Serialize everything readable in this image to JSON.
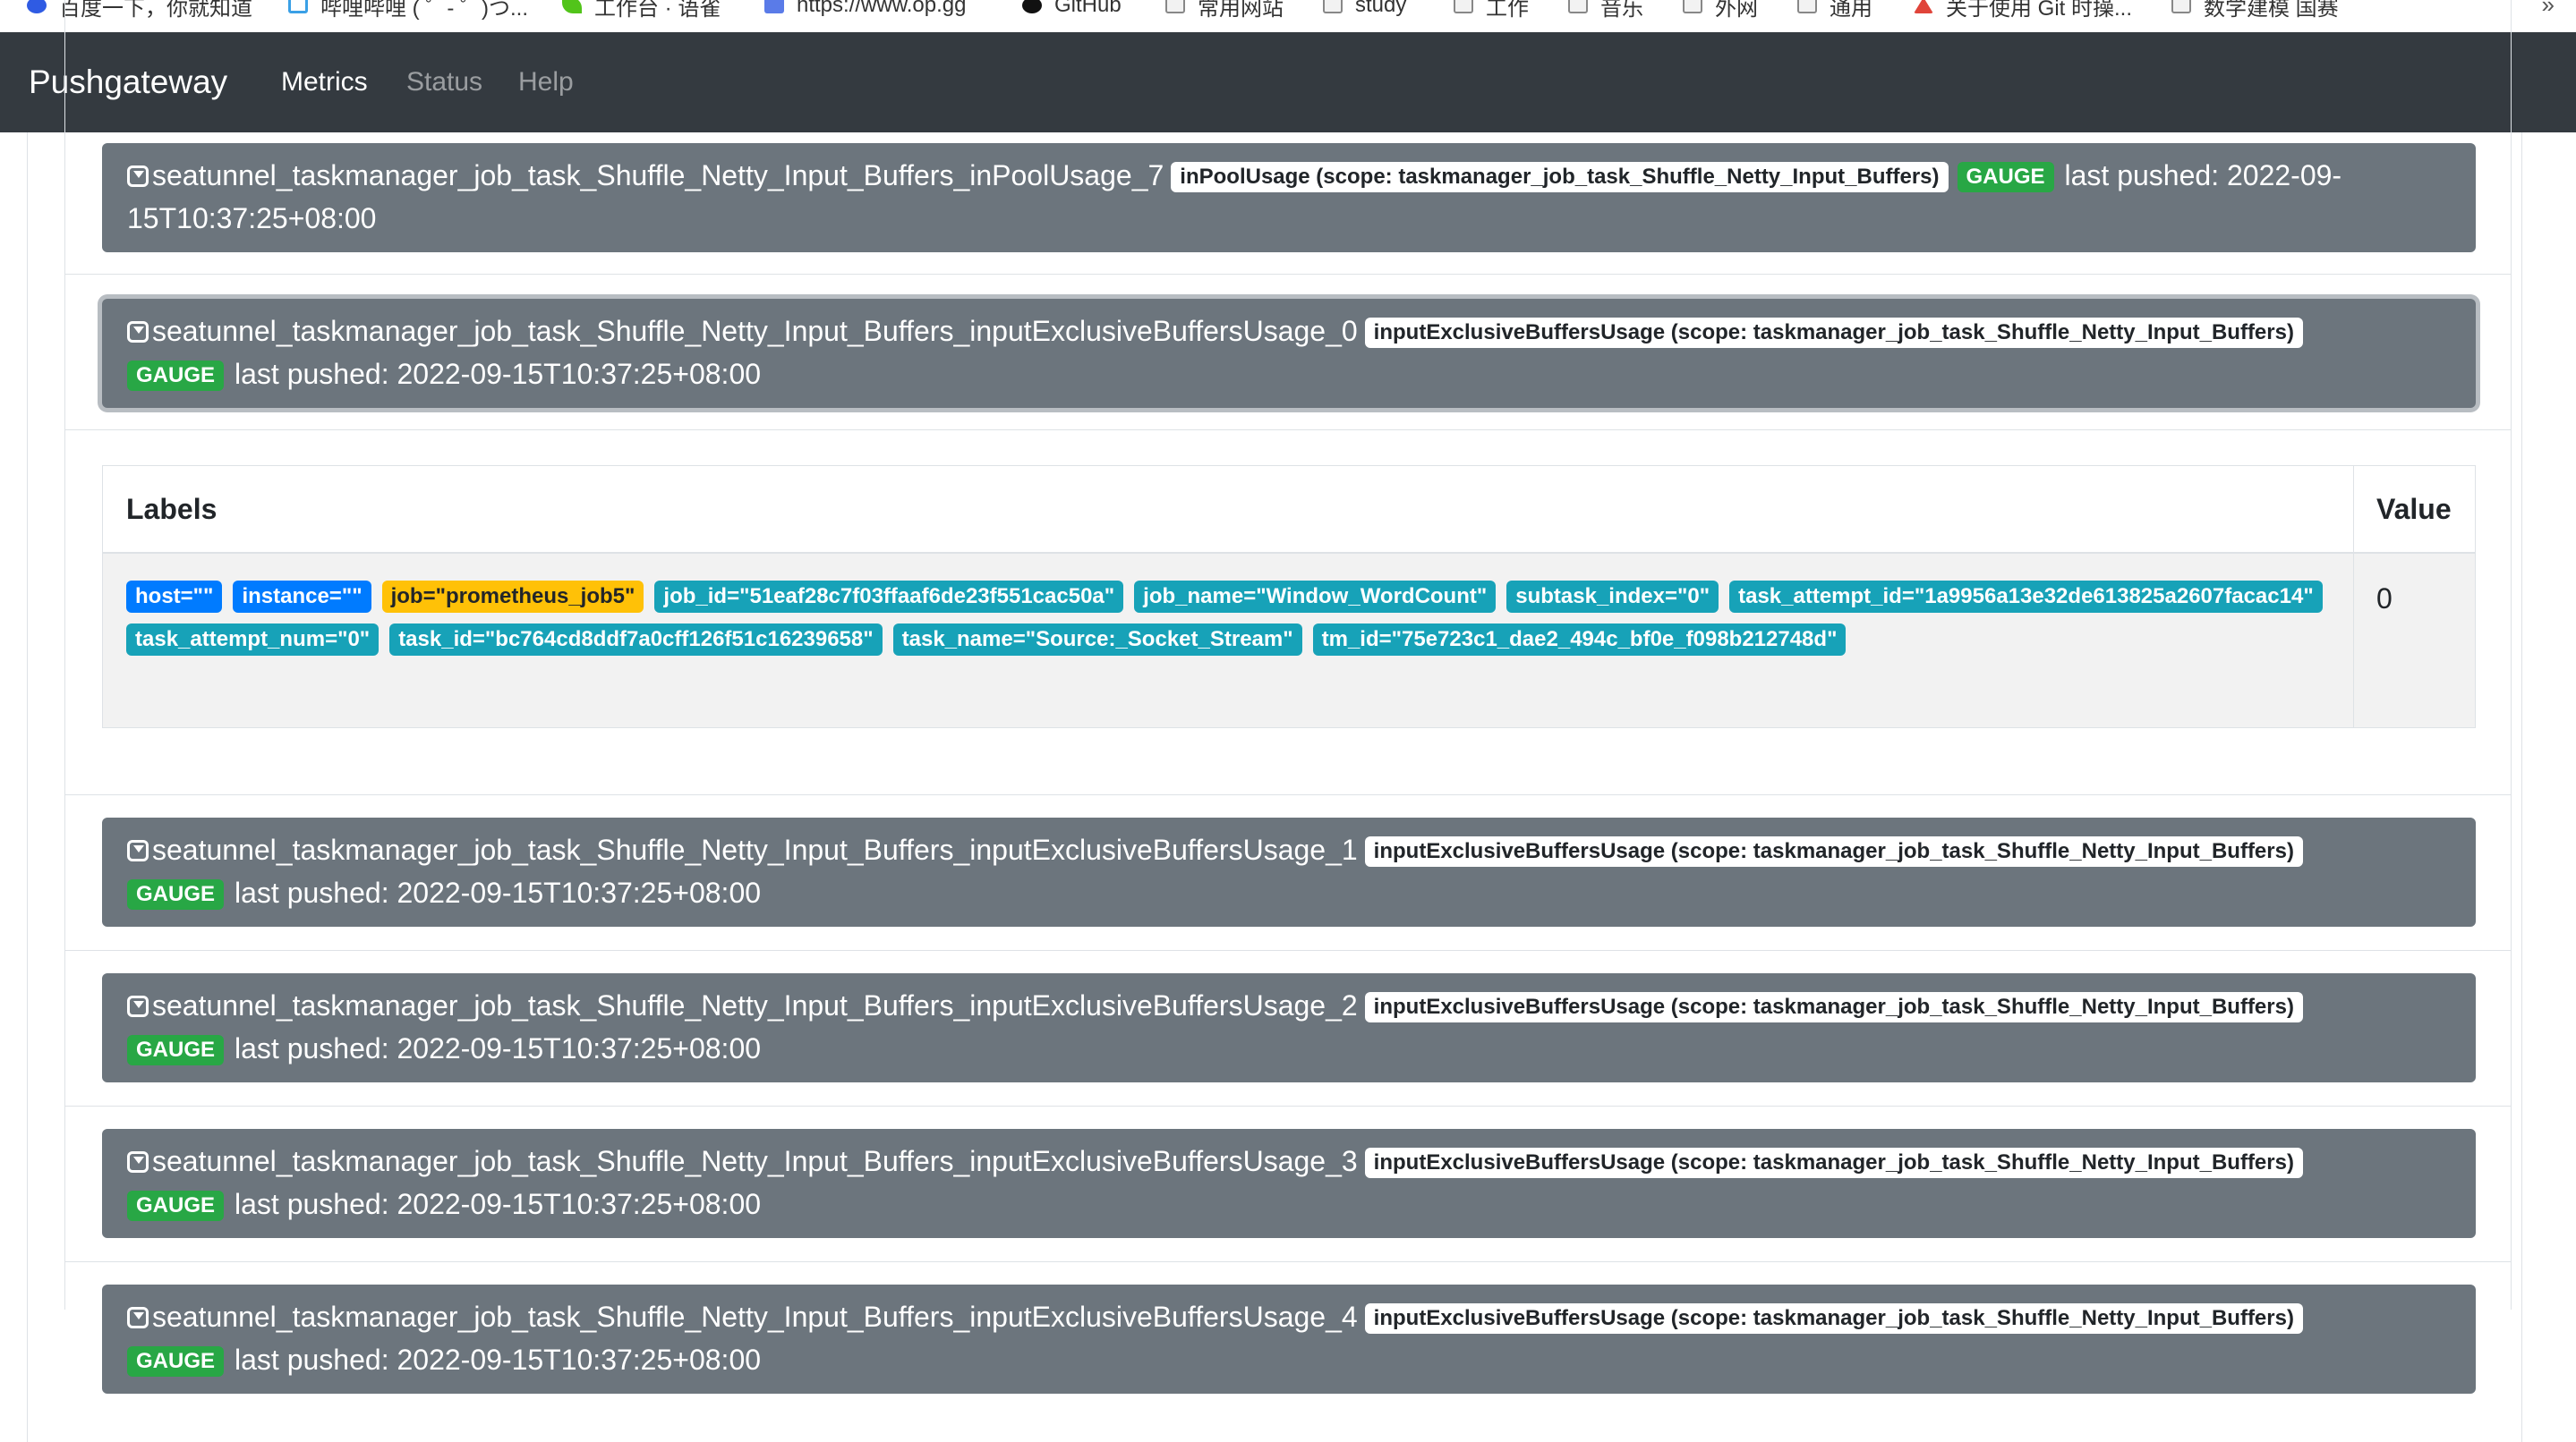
{
  "bookmarks": [
    {
      "label": "百度一下，你就知道",
      "icon": "paw-icon"
    },
    {
      "label": "哔哩哔哩 ( ゜- ゜)つ...",
      "icon": "bilibili-icon"
    },
    {
      "label": "工作台 · 语雀",
      "icon": "leaf-icon"
    },
    {
      "label": "https://www.op.gg",
      "icon": "opgg-icon"
    },
    {
      "label": "GitHub",
      "icon": "github-icon"
    },
    {
      "label": "常用网站",
      "icon": "folder-icon"
    },
    {
      "label": "study",
      "icon": "folder-icon"
    },
    {
      "label": "工作",
      "icon": "folder-icon"
    },
    {
      "label": "音乐",
      "icon": "folder-icon"
    },
    {
      "label": "外网",
      "icon": "folder-icon"
    },
    {
      "label": "通用",
      "icon": "folder-icon"
    },
    {
      "label": "关于使用 Git 时操...",
      "icon": "arrow-icon"
    },
    {
      "label": "数学建模 国赛",
      "icon": "folder-icon"
    }
  ],
  "bookmarks_more": "»",
  "navbar": {
    "brand": "Pushgateway",
    "links": [
      {
        "label": "Metrics",
        "active": true
      },
      {
        "label": "Status",
        "active": false
      },
      {
        "label": "Help",
        "active": false
      }
    ]
  },
  "metrics": [
    {
      "name": "seatunnel_taskmanager_job_task_Shuffle_Netty_Input_Buffers_inPoolUsage_7",
      "help": "inPoolUsage (scope: taskmanager_job_task_Shuffle_Netty_Input_Buffers)",
      "type": "GAUGE",
      "last_pushed": "last pushed: 2022-09-15T10:37:25+08:00"
    },
    {
      "name": "seatunnel_taskmanager_job_task_Shuffle_Netty_Input_Buffers_inputExclusiveBuffersUsage_0",
      "help": "inputExclusiveBuffersUsage (scope: taskmanager_job_task_Shuffle_Netty_Input_Buffers)",
      "type": "GAUGE",
      "last_pushed": "last pushed: 2022-09-15T10:37:25+08:00"
    },
    {
      "name": "seatunnel_taskmanager_job_task_Shuffle_Netty_Input_Buffers_inputExclusiveBuffersUsage_1",
      "help": "inputExclusiveBuffersUsage (scope: taskmanager_job_task_Shuffle_Netty_Input_Buffers)",
      "type": "GAUGE",
      "last_pushed": "last pushed: 2022-09-15T10:37:25+08:00"
    },
    {
      "name": "seatunnel_taskmanager_job_task_Shuffle_Netty_Input_Buffers_inputExclusiveBuffersUsage_2",
      "help": "inputExclusiveBuffersUsage (scope: taskmanager_job_task_Shuffle_Netty_Input_Buffers)",
      "type": "GAUGE",
      "last_pushed": "last pushed: 2022-09-15T10:37:25+08:00"
    },
    {
      "name": "seatunnel_taskmanager_job_task_Shuffle_Netty_Input_Buffers_inputExclusiveBuffersUsage_3",
      "help": "inputExclusiveBuffersUsage (scope: taskmanager_job_task_Shuffle_Netty_Input_Buffers)",
      "type": "GAUGE",
      "last_pushed": "last pushed: 2022-09-15T10:37:25+08:00"
    },
    {
      "name": "seatunnel_taskmanager_job_task_Shuffle_Netty_Input_Buffers_inputExclusiveBuffersUsage_4",
      "help": "inputExclusiveBuffersUsage (scope: taskmanager_job_task_Shuffle_Netty_Input_Buffers)",
      "type": "GAUGE",
      "last_pushed": "last pushed: 2022-09-15T10:37:25+08:00"
    }
  ],
  "labels_table": {
    "headers": {
      "labels": "Labels",
      "value": "Value"
    },
    "labels": [
      {
        "text": "host=\"\"",
        "color": "blue"
      },
      {
        "text": "instance=\"\"",
        "color": "blue"
      },
      {
        "text": "job=\"prometheus_job5\"",
        "color": "yellow"
      },
      {
        "text": "job_id=\"51eaf28c7f03ffaaf6de23f551cac50a\"",
        "color": "teal"
      },
      {
        "text": "job_name=\"Window_WordCount\"",
        "color": "teal"
      },
      {
        "text": "subtask_index=\"0\"",
        "color": "teal"
      },
      {
        "text": "task_attempt_id=\"1a9956a13e32de613825a2607facac14\"",
        "color": "teal"
      },
      {
        "text": "task_attempt_num=\"0\"",
        "color": "teal"
      },
      {
        "text": "task_id=\"bc764cd8ddf7a0cff126f51c16239658\"",
        "color": "teal"
      },
      {
        "text": "task_name=\"Source:_Socket_Stream\"",
        "color": "teal"
      },
      {
        "text": "tm_id=\"75e723c1_dae2_494c_bf0e_f098b212748d\"",
        "color": "teal"
      }
    ],
    "value": "0"
  },
  "colors": {
    "navbar": "#343a40",
    "card": "#6c757d",
    "gauge": "#28a745",
    "label_blue": "#007bff",
    "label_yellow": "#ffc107",
    "label_teal": "#17a2b8"
  }
}
